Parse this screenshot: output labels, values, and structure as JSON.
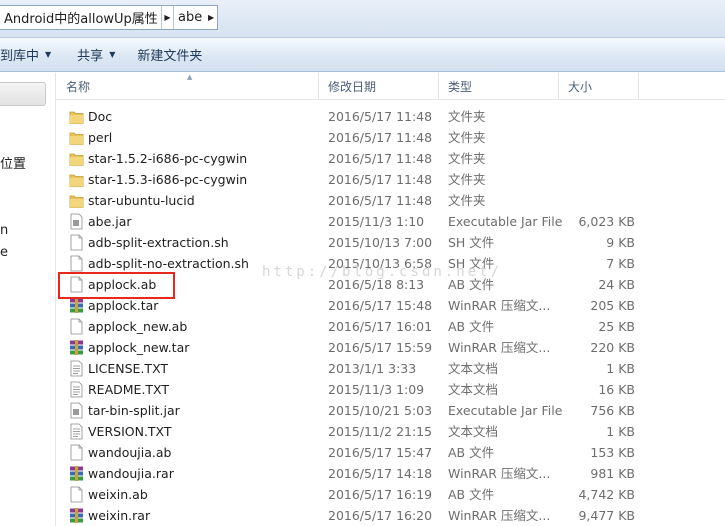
{
  "address": {
    "crumbs": [
      "Android中的allowUp属性",
      "abe"
    ]
  },
  "toolbar": {
    "add_to_library_label": "到库中",
    "share_label": "共享",
    "new_folder_label": "新建文件夹"
  },
  "nav": {
    "item_location": "位置",
    "fragment_n": "n",
    "fragment_e": "e"
  },
  "columns": {
    "name": "名称",
    "modified": "修改日期",
    "type": "类型",
    "size": "大小"
  },
  "watermark": "http://blog.csdn.net/",
  "files": [
    {
      "name": "Doc",
      "date": "2016/5/17 11:48",
      "type": "文件夹",
      "size": "",
      "icon": "folder-icon"
    },
    {
      "name": "perl",
      "date": "2016/5/17 11:48",
      "type": "文件夹",
      "size": "",
      "icon": "folder-icon"
    },
    {
      "name": "star-1.5.2-i686-pc-cygwin",
      "date": "2016/5/17 11:48",
      "type": "文件夹",
      "size": "",
      "icon": "folder-icon"
    },
    {
      "name": "star-1.5.3-i686-pc-cygwin",
      "date": "2016/5/17 11:48",
      "type": "文件夹",
      "size": "",
      "icon": "folder-icon"
    },
    {
      "name": "star-ubuntu-lucid",
      "date": "2016/5/17 11:48",
      "type": "文件夹",
      "size": "",
      "icon": "folder-icon"
    },
    {
      "name": "abe.jar",
      "date": "2015/11/3 1:10",
      "type": "Executable Jar File",
      "size": "6,023 KB",
      "icon": "jar-file-icon"
    },
    {
      "name": "adb-split-extraction.sh",
      "date": "2015/10/13 7:00",
      "type": "SH 文件",
      "size": "9 KB",
      "icon": "file-icon"
    },
    {
      "name": "adb-split-no-extraction.sh",
      "date": "2015/10/13 6:58",
      "type": "SH 文件",
      "size": "7 KB",
      "icon": "file-icon"
    },
    {
      "name": "applock.ab",
      "date": "2016/5/18 8:13",
      "type": "AB 文件",
      "size": "24 KB",
      "icon": "file-icon"
    },
    {
      "name": "applock.tar",
      "date": "2016/5/17 15:48",
      "type": "WinRAR 压缩文...",
      "size": "205 KB",
      "icon": "winrar-archive-icon"
    },
    {
      "name": "applock_new.ab",
      "date": "2016/5/17 16:01",
      "type": "AB 文件",
      "size": "25 KB",
      "icon": "file-icon"
    },
    {
      "name": "applock_new.tar",
      "date": "2016/5/17 15:59",
      "type": "WinRAR 压缩文...",
      "size": "220 KB",
      "icon": "winrar-archive-icon"
    },
    {
      "name": "LICENSE.TXT",
      "date": "2013/1/1 3:33",
      "type": "文本文档",
      "size": "1 KB",
      "icon": "text-file-icon"
    },
    {
      "name": "README.TXT",
      "date": "2015/11/3 1:09",
      "type": "文本文档",
      "size": "16 KB",
      "icon": "text-file-icon"
    },
    {
      "name": "tar-bin-split.jar",
      "date": "2015/10/21 5:03",
      "type": "Executable Jar File",
      "size": "756 KB",
      "icon": "jar-file-icon"
    },
    {
      "name": "VERSION.TXT",
      "date": "2015/11/2 21:15",
      "type": "文本文档",
      "size": "1 KB",
      "icon": "text-file-icon"
    },
    {
      "name": "wandoujia.ab",
      "date": "2016/5/17 15:47",
      "type": "AB 文件",
      "size": "153 KB",
      "icon": "file-icon"
    },
    {
      "name": "wandoujia.rar",
      "date": "2016/5/17 14:18",
      "type": "WinRAR 压缩文...",
      "size": "981 KB",
      "icon": "winrar-archive-icon"
    },
    {
      "name": "weixin.ab",
      "date": "2016/5/17 16:19",
      "type": "AB 文件",
      "size": "4,742 KB",
      "icon": "file-icon"
    },
    {
      "name": "weixin.rar",
      "date": "2016/5/17 16:20",
      "type": "WinRAR 压缩文...",
      "size": "9,477 KB",
      "icon": "winrar-archive-icon"
    }
  ],
  "colors": {
    "highlight_border": "#e8281e",
    "folder": "#e8c25a",
    "accent_text": "#1e395b"
  }
}
